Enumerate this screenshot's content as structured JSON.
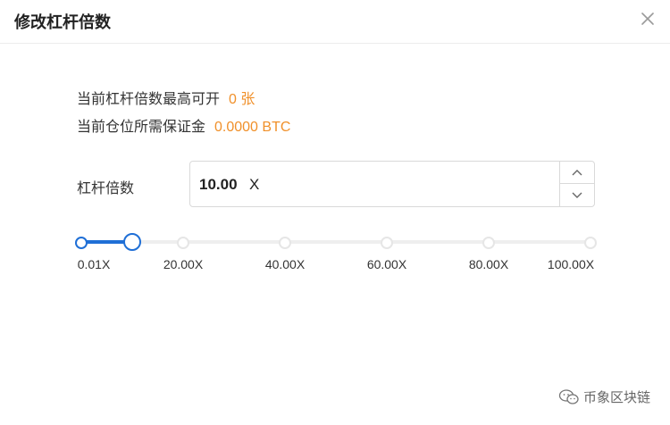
{
  "dialog": {
    "title": "修改杠杆倍数",
    "close_icon": "close-icon"
  },
  "info": {
    "max_open_label": "当前杠杆倍数最高可开",
    "max_open_value": "0 张",
    "margin_label": "当前仓位所需保证金",
    "margin_value": "0.0000 BTC"
  },
  "leverage": {
    "label": "杠杆倍数",
    "value": "10.00",
    "unit": "X",
    "stepper_up_icon": "chevron-up-icon",
    "stepper_down_icon": "chevron-down-icon"
  },
  "slider": {
    "level_fraction": 0.1,
    "marks": [
      "0.01X",
      "20.00X",
      "40.00X",
      "60.00X",
      "80.00X",
      "100.00X"
    ]
  },
  "watermark": {
    "text": "币象区块链",
    "icon": "wechat-icon"
  },
  "colors": {
    "accent": "#1f6fd6",
    "highlight": "#f0902a"
  }
}
